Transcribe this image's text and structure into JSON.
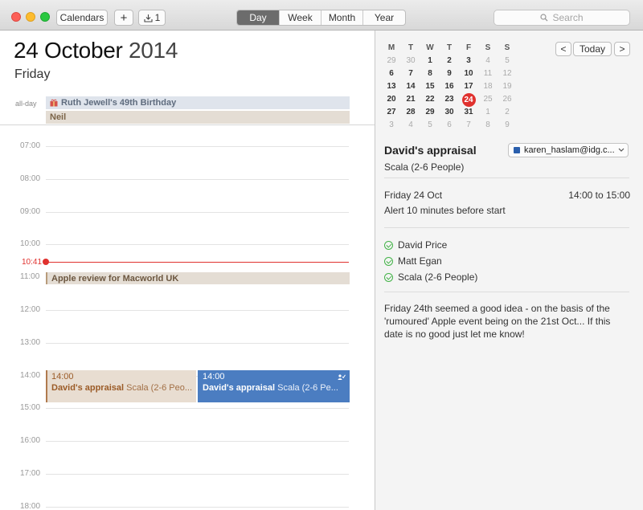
{
  "toolbar": {
    "calendars_label": "Calendars",
    "add_label": "+",
    "inbox_count": "1",
    "views": [
      "Day",
      "Week",
      "Month",
      "Year"
    ],
    "active_view": "Day",
    "search_placeholder": "Search"
  },
  "day": {
    "date_text": "24 October",
    "year_text": "2014",
    "weekday": "Friday",
    "allday_label": "all-day",
    "allday_events": [
      "Ruth Jewell's 49th Birthday",
      "Neil"
    ],
    "hours": [
      "07:00",
      "08:00",
      "09:00",
      "10:00",
      "11:00",
      "12:00",
      "13:00",
      "14:00",
      "15:00",
      "16:00",
      "17:00",
      "18:00"
    ],
    "now_time": "10:41",
    "events": {
      "apple_review": "Apple review for Macworld UK",
      "appraisal_1": {
        "time": "14:00",
        "title": "David's appraisal",
        "location": "Scala (2-6 Peo..."
      },
      "appraisal_2": {
        "time": "14:00",
        "title": "David's appraisal",
        "location": "Scala (2-6 Pe..."
      }
    }
  },
  "mini_calendar": {
    "weekdays": [
      "M",
      "T",
      "W",
      "T",
      "F",
      "S",
      "S"
    ],
    "weeks": [
      [
        [
          "29",
          "other"
        ],
        [
          "30",
          "other"
        ],
        [
          "1",
          ""
        ],
        [
          "2",
          ""
        ],
        [
          "3",
          ""
        ],
        [
          "4",
          "other"
        ],
        [
          "5",
          "other"
        ]
      ],
      [
        [
          "6",
          ""
        ],
        [
          "7",
          ""
        ],
        [
          "8",
          ""
        ],
        [
          "9",
          ""
        ],
        [
          "10",
          ""
        ],
        [
          "11",
          "other"
        ],
        [
          "12",
          "other"
        ]
      ],
      [
        [
          "13",
          ""
        ],
        [
          "14",
          ""
        ],
        [
          "15",
          ""
        ],
        [
          "16",
          ""
        ],
        [
          "17",
          ""
        ],
        [
          "18",
          "other"
        ],
        [
          "19",
          "other"
        ]
      ],
      [
        [
          "20",
          ""
        ],
        [
          "21",
          ""
        ],
        [
          "22",
          ""
        ],
        [
          "23",
          ""
        ],
        [
          "24",
          "today"
        ],
        [
          "25",
          "other"
        ],
        [
          "26",
          "other"
        ]
      ],
      [
        [
          "27",
          ""
        ],
        [
          "28",
          ""
        ],
        [
          "29",
          ""
        ],
        [
          "30",
          ""
        ],
        [
          "31",
          ""
        ],
        [
          "1",
          "other"
        ],
        [
          "2",
          "other"
        ]
      ],
      [
        [
          "3",
          "other"
        ],
        [
          "4",
          "other"
        ],
        [
          "5",
          "other"
        ],
        [
          "6",
          "other"
        ],
        [
          "7",
          "other"
        ],
        [
          "8",
          "other"
        ],
        [
          "9",
          "other"
        ]
      ]
    ],
    "prev_label": "<",
    "today_label": "Today",
    "next_label": ">"
  },
  "detail": {
    "title": "David's appraisal",
    "location": "Scala (2-6 People)",
    "calendar": "karen_haslam@idg.c...",
    "date": "Friday 24 Oct",
    "time": "14:00 to 15:00",
    "alert": "Alert 10 minutes before start",
    "attendees": [
      "David Price",
      "Matt Egan",
      "Scala (2-6 People)"
    ],
    "notes": "Friday 24th seemed a good idea - on the basis of the 'rumoured' Apple event being on the 21st Oct... If this date is no good just let me know!"
  },
  "colors": {
    "today_red": "#e0312e",
    "event_blue": "#4b7dc1",
    "event_brown": "#e8ddd1"
  }
}
